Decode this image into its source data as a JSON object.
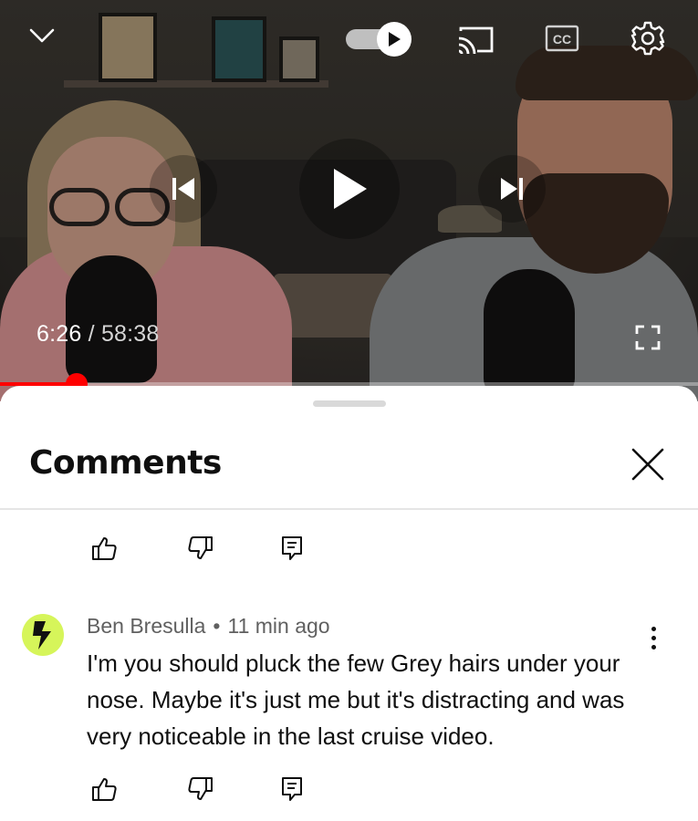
{
  "player": {
    "current_time": "6:26",
    "separator": "/",
    "duration": "58:38",
    "progress_fraction": 0.11,
    "autoplay_on": true,
    "cc_label": "CC",
    "icons": [
      "chevron-down-icon",
      "autoplay-toggle",
      "cast-icon",
      "cc-icon",
      "settings-gear-icon",
      "previous-icon",
      "play-icon",
      "next-icon",
      "fullscreen-icon"
    ],
    "accent_color": "#ff0000"
  },
  "comments_panel": {
    "title": "Comments",
    "close_icon": "close-icon",
    "previous_comment_actions": {
      "icons": [
        "thumb-up-icon",
        "thumb-down-icon",
        "reply-icon"
      ]
    },
    "comments": [
      {
        "author": "Ben Bresulla",
        "dot": "•",
        "time": "11 min ago",
        "text": "I'm you should pluck the few Grey hairs under your nose. Maybe it's just me but it's distracting and was very noticeable in the last cruise video.",
        "avatar_color": "#d6f55a",
        "actions": [
          "thumb-up-icon",
          "thumb-down-icon",
          "reply-icon"
        ]
      }
    ]
  }
}
